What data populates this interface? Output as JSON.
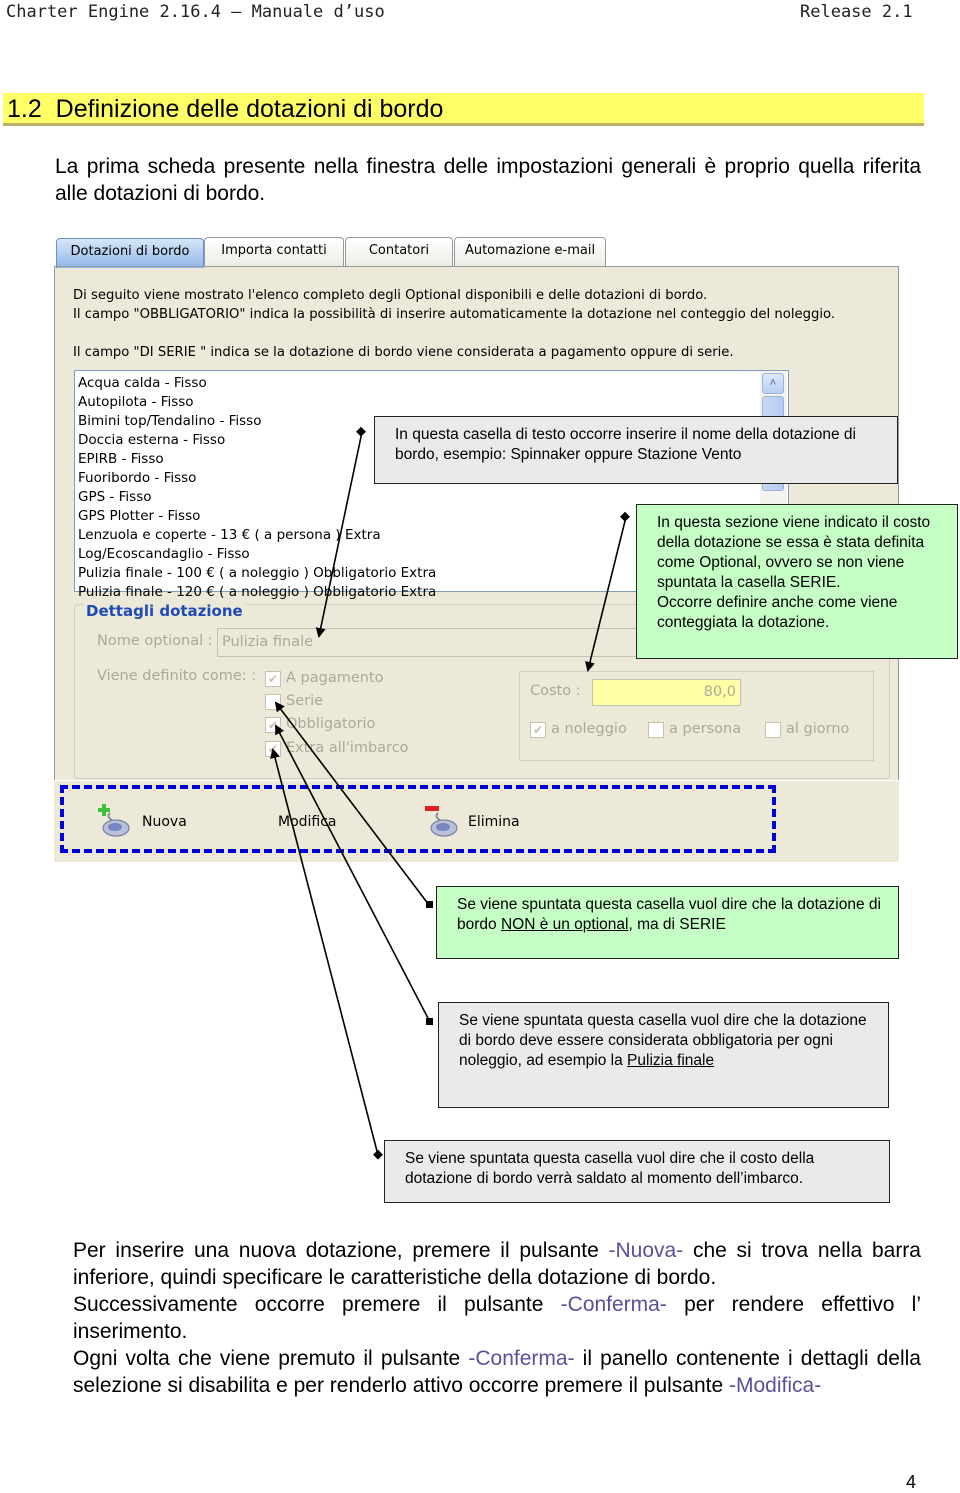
{
  "header": {
    "title": "Charter Engine 2.16.4 – Manuale d’uso",
    "release": "Release 2.1"
  },
  "section": {
    "number": "1.2",
    "title": "Definizione delle dotazioni di bordo"
  },
  "intro": "La prima scheda presente nella finestra delle impostazioni generali è proprio quella riferita alle dotazioni di bordo.",
  "window": {
    "tabs": [
      {
        "label": "Dotazioni di bordo",
        "active": true
      },
      {
        "label": "Importa contatti",
        "active": false
      },
      {
        "label": "Contatori",
        "active": false
      },
      {
        "label": "Automazione e-mail",
        "active": false
      }
    ],
    "description": [
      "Di seguito viene mostrato l'elenco completo degli Optional disponibili e delle dotazioni di bordo.",
      "Il campo \"OBBLIGATORIO\" indica la possibilità di inserire automaticamente la dotazione nel conteggio del noleggio.",
      "Il campo \"DI SERIE \" indica se la dotazione di bordo viene considerata a pagamento oppure di serie."
    ],
    "list_items": [
      "Acqua calda - Fisso",
      "Autopilota - Fisso",
      "Bimini top/Tendalino - Fisso",
      "Doccia esterna - Fisso",
      "EPIRB - Fisso",
      "Fuoribordo - Fisso",
      "GPS - Fisso",
      "GPS Plotter - Fisso",
      "Lenzuola e coperte - 13 € ( a persona ) Extra",
      "Log/Ecoscandaglio - Fisso",
      "Pulizia finale - 100 € ( a noleggio ) Obbligatorio Extra",
      "Pulizia finale - 120 € ( a noleggio ) Obbligatorio Extra"
    ],
    "scroll_up_icon": "˄",
    "details": {
      "title": "Dettagli dotazione",
      "name_label": "Nome optional :",
      "name_value": "Pulizia finale",
      "defined_label": "Viene definito come:  :",
      "checkboxes": [
        {
          "label": "A pagamento",
          "checked": true
        },
        {
          "label": "Serie",
          "checked": false
        },
        {
          "label": "Obbligatorio",
          "checked": true
        },
        {
          "label": "Extra all'imbarco",
          "checked": true
        }
      ],
      "cost_label": "Costo :",
      "cost_value": "80,0",
      "cost_checkboxes": [
        {
          "label": "a noleggio",
          "checked": true
        },
        {
          "label": "a persona",
          "checked": false
        },
        {
          "label": "al giorno",
          "checked": false
        }
      ]
    },
    "toolbar": {
      "new": "Nuova",
      "edit": "Modifica",
      "delete": "Elimina"
    },
    "check_glyph": "✔"
  },
  "callouts": {
    "name_field": "In questa casella di testo occorre inserire il nome della dotazione di bordo, esempio: Spinnaker oppure Stazione Vento",
    "cost_section": {
      "text": "In questa sezione viene indicato il costo della dotazione se essa è stata definita come Optional, ovvero se non viene spuntata la casella SERIE.",
      "text2": "Occorre definire anche come viene conteggiata la dotazione."
    },
    "serie": {
      "before": "Se viene spuntata questa casella vuol dire che la dotazione di bordo ",
      "underlined": "NON è un optional",
      "after": ", ma di SERIE"
    },
    "obbligatorio": {
      "before": "Se viene spuntata questa casella vuol dire che la dotazione di bordo deve essere considerata obbligatoria per ogni noleggio, ad esempio la ",
      "underlined": "Pulizia finale"
    },
    "extra": "Se viene spuntata questa casella vuol dire che il costo della dotazione di bordo verrà saldato al momento dell’imbarco."
  },
  "body": {
    "p1_a": "Per inserire una nuova dotazione, premere il pulsante ",
    "p1_hl": "-Nuova-",
    "p1_b": " che si trova nella barra inferiore, quindi specificare le caratteristiche della dotazione di bordo.",
    "p2_a": "Successivamente occorre premere il pulsante ",
    "p2_hl": "-Conferma-",
    "p2_b": " per rendere effettivo l’ inserimento.",
    "p3_a": "Ogni volta che viene premuto il pulsante ",
    "p3_hl": "-Conferma-",
    "p3_b": " il panello contenente i dettagli della selezione si disabilita e per renderlo attivo occorre premere il pulsante ",
    "p3_hl2": "-Modifica-"
  },
  "page_number": "4",
  "colors": {
    "section_bg": "#ffff66",
    "callout_gray": "#eaeaea",
    "callout_green": "#c6ffc6",
    "highlight_text": "#5a4f9a",
    "toolbar_dash": "#0000dd"
  }
}
